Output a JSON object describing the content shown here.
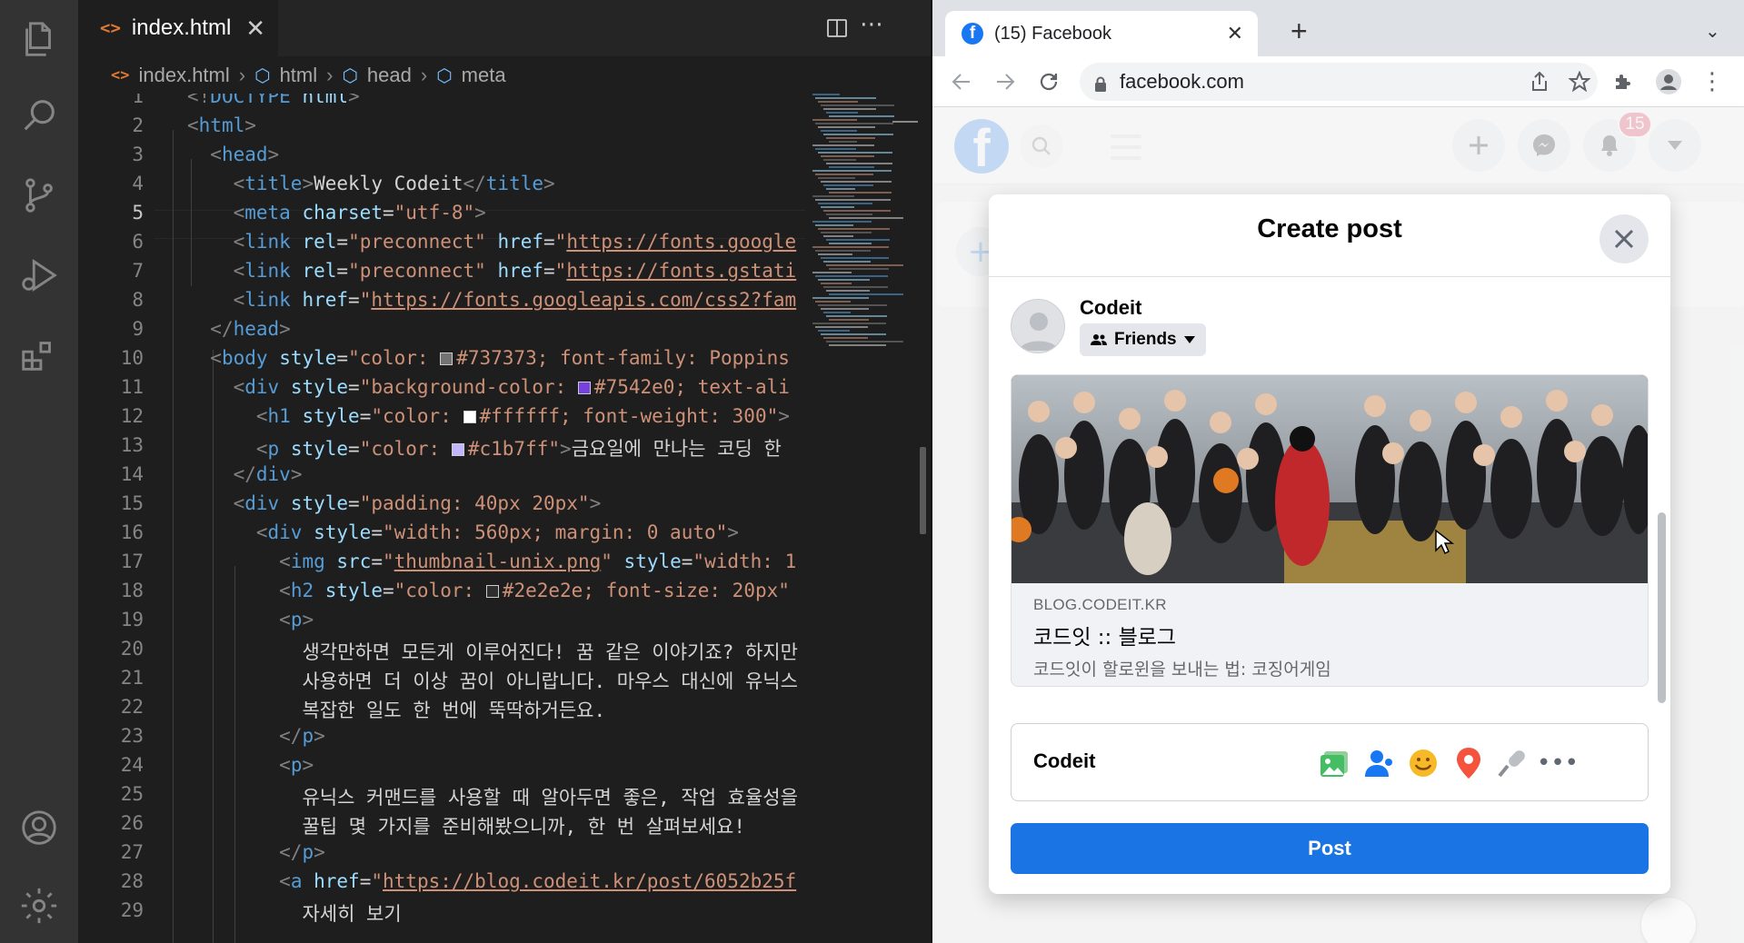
{
  "vscode": {
    "tab": {
      "label": "index.html",
      "icon": "html-file-icon",
      "close": "✕"
    },
    "breadcrumb": [
      "index.html",
      "html",
      "head",
      "meta"
    ],
    "current_line": 5,
    "line_numbers": [
      "1",
      "2",
      "3",
      "4",
      "5",
      "6",
      "7",
      "8",
      "9",
      "10",
      "11",
      "12",
      "13",
      "14",
      "15",
      "16",
      "17",
      "18",
      "19",
      "20",
      "21",
      "22",
      "23",
      "24",
      "25",
      "26",
      "27",
      "28",
      "29"
    ],
    "activity_icons": [
      "explorer-icon",
      "search-icon",
      "source-control-icon",
      "run-debug-icon",
      "extensions-icon",
      "account-icon",
      "settings-gear-icon"
    ],
    "swatches": [
      "#737373",
      "#7542e0",
      "#ffffff",
      "#c1b7ff",
      "#2e2e2e"
    ],
    "korean": {
      "l13": "금요일에 만나는 코딩 한 ",
      "l20": "생각만하면 모든게 이루어진다! 꿈 같은 이야기죠? 하지만 ",
      "l21": "사용하면 더 이상 꿈이 아니랍니다. 마우스 대신에 유닉스 ",
      "l22": "복잡한 일도 한 번에 뚝딱하거든요.",
      "l25": "유닉스 커맨드를 사용할 때 알아두면 좋은, 작업 효율성을 ",
      "l26": "꿀팁 몇 가지를 준비해봤으니까, 한 번 살펴보세요!",
      "l29": "자세히 보기"
    }
  },
  "chrome": {
    "tab_title": "(15) Facebook",
    "tab_close": "✕",
    "new_tab": "+",
    "url": "facebook.com"
  },
  "facebook": {
    "logo": "f",
    "notification_count": "15",
    "modal": {
      "title": "Create post",
      "author": "Codeit",
      "audience": "Friends",
      "preview": {
        "domain": "BLOG.CODEIT.KR",
        "title": "코드잇 :: 블로그",
        "description": "코드잇이 할로윈을 보내는 법: 코징어게임"
      },
      "add_to_post_label": "Codeit",
      "add_icons": [
        "photo-video-icon",
        "tag-people-icon",
        "feeling-icon",
        "check-in-icon",
        "live-video-icon",
        "more-icon"
      ],
      "post_button": "Post"
    }
  }
}
